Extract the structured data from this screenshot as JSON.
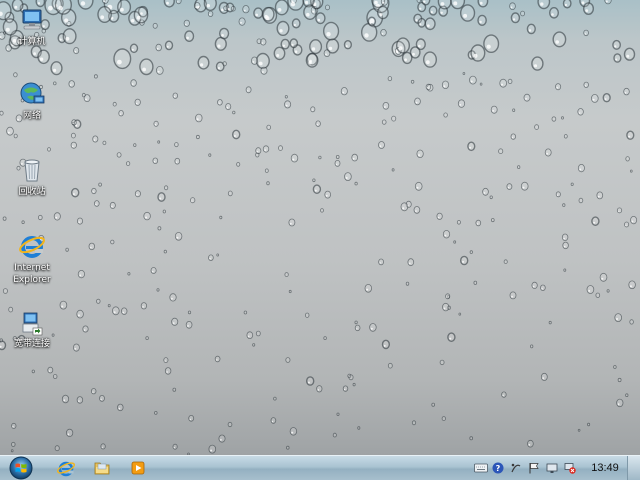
{
  "desktop": {
    "icons": [
      {
        "name": "computer",
        "label": "计算机",
        "icon": "computer-icon"
      },
      {
        "name": "network",
        "label": "网络",
        "icon": "network-icon"
      },
      {
        "name": "recycle-bin",
        "label": "回收站",
        "icon": "recycle-bin-icon"
      },
      {
        "name": "internet-explorer",
        "label": "Internet Explorer",
        "icon": "ie-icon"
      },
      {
        "name": "broadband",
        "label": "宽带连接",
        "icon": "broadband-connection-icon"
      }
    ]
  },
  "taskbar": {
    "start_icon": "windows-orb-icon",
    "pinned": [
      {
        "name": "internet-explorer",
        "icon": "ie-icon"
      },
      {
        "name": "explorer",
        "icon": "folder-icon"
      },
      {
        "name": "media-player",
        "icon": "media-player-icon"
      }
    ],
    "tray": {
      "icons": [
        "keyboard-icon",
        "help-icon",
        "input-method-icon",
        "flag-icon",
        "display-icon",
        "network-disconnected-icon"
      ],
      "clock": "13:49"
    }
  },
  "colors": {
    "taskbar": "#a9c3d2",
    "icon_label_text": "#ffffff"
  }
}
